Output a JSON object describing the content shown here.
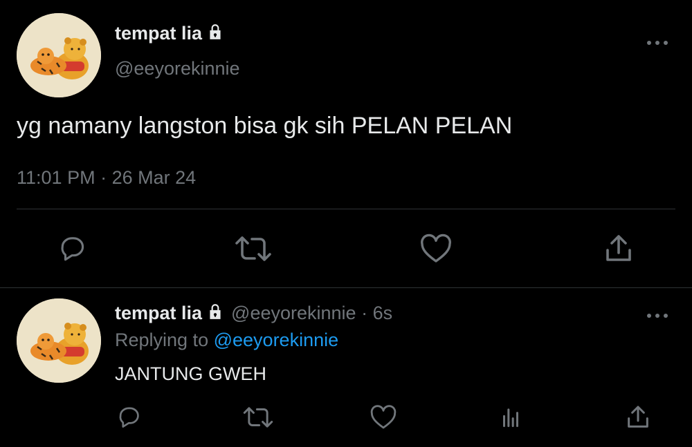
{
  "colors": {
    "background": "#000000",
    "text_primary": "#e7e9ea",
    "text_secondary": "#71767b",
    "link": "#1d9bf0",
    "divider": "#2f3336"
  },
  "main_tweet": {
    "display_name": "tempat lia",
    "handle": "@eeyorekinnie",
    "text": "yg namany langston bisa gk sih PELAN PELAN",
    "time": "11:01 PM",
    "separator": "·",
    "date": "26 Mar 24",
    "icons": {
      "verified_lock": "lock-icon",
      "more": "more-horizontal-icon",
      "reply": "reply-icon",
      "retweet": "retweet-icon",
      "like": "heart-icon",
      "share": "share-icon"
    }
  },
  "reply_tweet": {
    "display_name": "tempat lia",
    "handle": "@eeyorekinnie",
    "separator": "·",
    "time_ago": "6s",
    "replying_to_label": "Replying to",
    "replying_to_handle": "@eeyorekinnie",
    "text": "JANTUNG GWEH",
    "icons": {
      "reply": "reply-icon",
      "retweet": "retweet-icon",
      "like": "heart-icon",
      "analytics": "analytics-icon",
      "share": "share-icon"
    }
  }
}
